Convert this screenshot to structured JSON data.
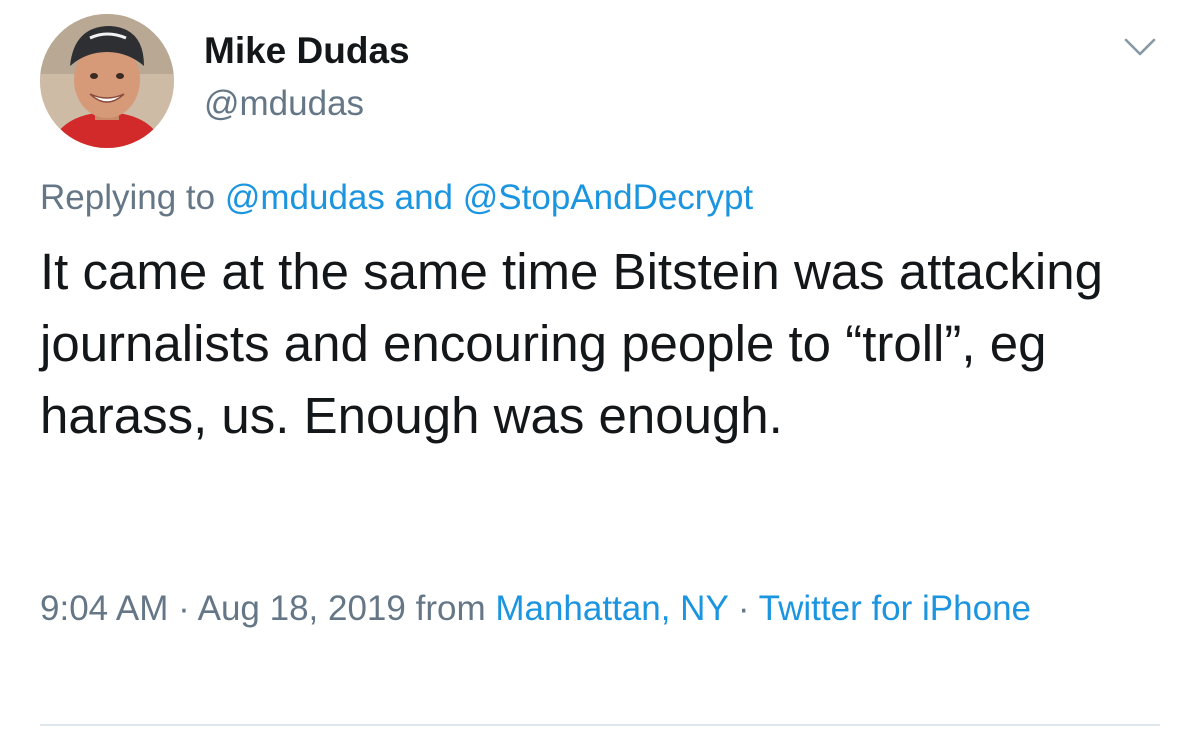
{
  "author": {
    "name": "Mike Dudas",
    "handle": "@mdudas"
  },
  "reply": {
    "prefix": "Replying to",
    "mention_1": "@mdudas",
    "joiner": "and",
    "mention_2": "@StopAndDecrypt"
  },
  "tweet": {
    "text": "It came at the same time Bitstein was attacking journalists and encouring people to “troll”, eg harass, us. Enough was enough."
  },
  "meta": {
    "time": "9:04 AM",
    "separator": "·",
    "date": "Aug 18, 2019",
    "from_label": "from",
    "location": "Manhattan, NY",
    "client": "Twitter for iPhone"
  },
  "icons": {
    "menu": "chevron-down-icon",
    "avatar": "avatar"
  },
  "colors": {
    "text": "#14171a",
    "secondary": "#657786",
    "link": "#1b95e0",
    "divider": "#e1e8ed"
  }
}
